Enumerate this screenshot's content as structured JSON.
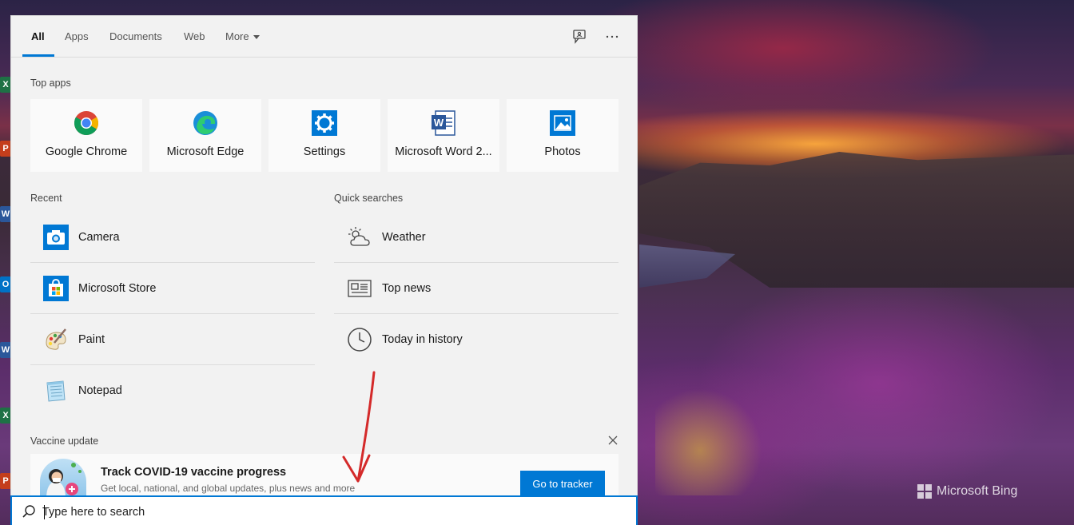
{
  "tabs": [
    {
      "label": "All",
      "active": true
    },
    {
      "label": "Apps",
      "active": false
    },
    {
      "label": "Documents",
      "active": false
    },
    {
      "label": "Web",
      "active": false
    },
    {
      "label": "More",
      "active": false
    }
  ],
  "top_apps": {
    "label": "Top apps",
    "items": [
      {
        "label": "Google Chrome",
        "icon": "chrome-icon"
      },
      {
        "label": "Microsoft Edge",
        "icon": "edge-icon"
      },
      {
        "label": "Settings",
        "icon": "settings-icon"
      },
      {
        "label": "Microsoft Word 2...",
        "icon": "word-icon"
      },
      {
        "label": "Photos",
        "icon": "photos-icon"
      }
    ]
  },
  "recent": {
    "label": "Recent",
    "items": [
      {
        "label": "Camera",
        "icon": "camera-icon"
      },
      {
        "label": "Microsoft Store",
        "icon": "store-icon"
      },
      {
        "label": "Paint",
        "icon": "paint-icon"
      },
      {
        "label": "Notepad",
        "icon": "notepad-icon"
      }
    ]
  },
  "quick_searches": {
    "label": "Quick searches",
    "items": [
      {
        "label": "Weather",
        "icon": "weather-icon"
      },
      {
        "label": "Top news",
        "icon": "news-icon"
      },
      {
        "label": "Today in history",
        "icon": "clock-icon"
      }
    ]
  },
  "vaccine": {
    "label": "Vaccine update",
    "title": "Track COVID-19 vaccine progress",
    "subtitle": "Get local, national, and global updates, plus news and more",
    "button": "Go to tracker"
  },
  "search": {
    "placeholder": "Type here to search"
  },
  "watermark": "Microsoft Bing",
  "colors": {
    "accent": "#0078d4",
    "annotation": "#d42a2a"
  }
}
